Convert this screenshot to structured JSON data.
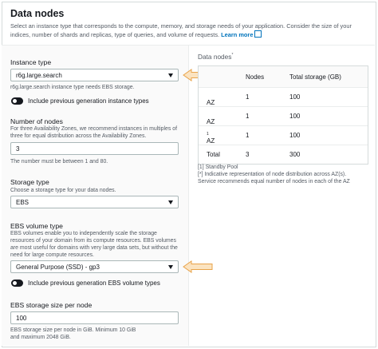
{
  "header": {
    "title": "Data nodes",
    "description": "Select an instance type that corresponds to the compute, memory, and storage needs of your application. Consider the size of your indices, number of shards and replicas, type of queries, and volume of requests.",
    "learn_more": "Learn more"
  },
  "instance_type": {
    "label": "Instance type",
    "value": "r6g.large.search",
    "hint": "r6g.large.search instance type needs EBS storage.",
    "toggle_label": "Include previous generation instance types"
  },
  "nodes": {
    "label": "Number of nodes",
    "hint": "For three Availability Zones, we recommend instances in multiples of three for equal distribution across the Availability Zones.",
    "value": "3",
    "constraint": "The number must be between 1 and 80."
  },
  "storage_type": {
    "label": "Storage type",
    "hint": "Choose a storage type for your data nodes.",
    "value": "EBS"
  },
  "ebs_volume": {
    "label": "EBS volume type",
    "hint": "EBS volumes enable you to independently scale the storage resources of your domain from its compute resources. EBS volumes are most useful for domains with very large data sets, but without the need for large compute resources.",
    "value": "General Purpose (SSD) - gp3",
    "toggle_label": "Include previous generation EBS volume types"
  },
  "ebs_size": {
    "label": "EBS storage size per node",
    "value": "100",
    "hint": "EBS storage size per node in GiB. Minimum 10 GiB and maximum 2048 GiB."
  },
  "summary": {
    "title": "Data nodes",
    "title_sup": "*",
    "headers": [
      "",
      "Nodes",
      "Total storage (GB)"
    ],
    "rows": [
      {
        "az": "AZ",
        "sup": "",
        "nodes": "1",
        "storage": "100"
      },
      {
        "az": "AZ",
        "sup": "",
        "nodes": "1",
        "storage": "100"
      },
      {
        "az": "AZ",
        "sup": "1",
        "nodes": "1",
        "storage": "100"
      },
      {
        "az": "Total",
        "sup": "",
        "nodes": "3",
        "storage": "300"
      }
    ],
    "notes": [
      "[1] Standby Pool",
      "[*] Indicative representation of node distribution across AZ(s).",
      "Service recommends equal number of nodes in each of the AZ"
    ]
  },
  "colors": {
    "link": "#0073bb",
    "arrow_fill": "#fbe3c0",
    "arrow_stroke": "#e8a34a"
  }
}
